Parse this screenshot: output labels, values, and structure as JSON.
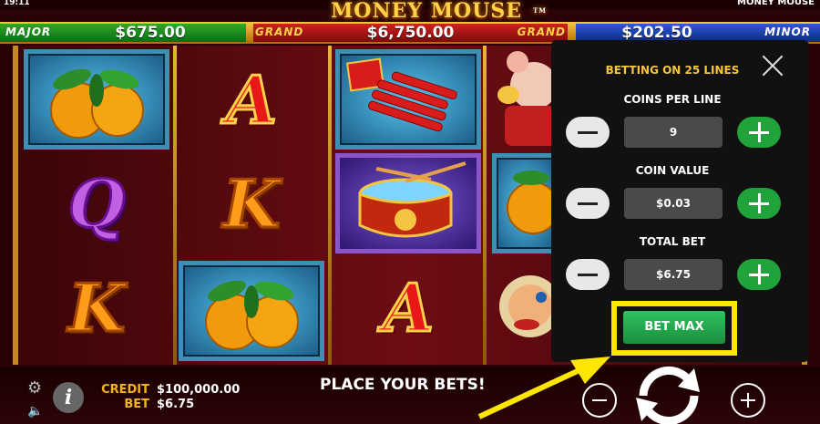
{
  "topbar": {
    "clock": "19:11",
    "game_name": "MONEY MOUSE",
    "logo": "MONEY MOUSE",
    "logo_tm": "TM"
  },
  "jackpots": {
    "major": {
      "label": "MAJOR",
      "value": "$675.00"
    },
    "grand": {
      "label_left": "GRAND",
      "label_right": "GRAND",
      "value": "$6,750.00"
    },
    "minor": {
      "label": "MINOR",
      "value": "$202.50"
    }
  },
  "reels": {
    "symbols": [
      {
        "reel": 1,
        "row": 1,
        "symbol": "tangerines",
        "icon": "tangerine-icon"
      },
      {
        "reel": 1,
        "row": 2,
        "symbol": "Q"
      },
      {
        "reel": 1,
        "row": 3,
        "symbol": "K"
      },
      {
        "reel": 2,
        "row": 1,
        "symbol": "A"
      },
      {
        "reel": 2,
        "row": 2,
        "symbol": "K"
      },
      {
        "reel": 2,
        "row": 3,
        "symbol": "tangerines",
        "icon": "tangerine-icon"
      },
      {
        "reel": 3,
        "row": 1,
        "symbol": "firecrackers",
        "icon": "firecracker-icon"
      },
      {
        "reel": 3,
        "row": 2,
        "symbol": "drum",
        "icon": "drum-icon"
      },
      {
        "reel": 3,
        "row": 3,
        "symbol": "A"
      },
      {
        "reel": 4,
        "row": 1,
        "symbol": "fortune mouse",
        "icon": "mouse-icon"
      },
      {
        "reel": 4,
        "row": 2,
        "symbol": "tangerines",
        "icon": "tangerine-icon"
      },
      {
        "reel": 4,
        "row": 3,
        "symbol": "lion",
        "icon": "lion-icon"
      }
    ],
    "letters": {
      "q": "Q",
      "k": "K",
      "a": "A"
    }
  },
  "panel": {
    "title": "BETTING ON 25 LINES",
    "coins_per_line": {
      "label": "COINS PER LINE",
      "value": "9"
    },
    "coin_value": {
      "label": "COIN VALUE",
      "value": "$0.03"
    },
    "total_bet": {
      "label": "TOTAL BET",
      "value": "$6.75"
    },
    "bet_max_label": "BET MAX"
  },
  "bottom": {
    "credit_label": "CREDIT",
    "credit_value": "$100,000.00",
    "bet_label": "BET",
    "bet_value": "$6.75",
    "message": "PLACE YOUR BETS!",
    "info_glyph": "i"
  },
  "colors": {
    "gold": "#f5c542",
    "highlight": "#ffe600",
    "green": "#1fa33a",
    "panel_bg": "#111111"
  }
}
